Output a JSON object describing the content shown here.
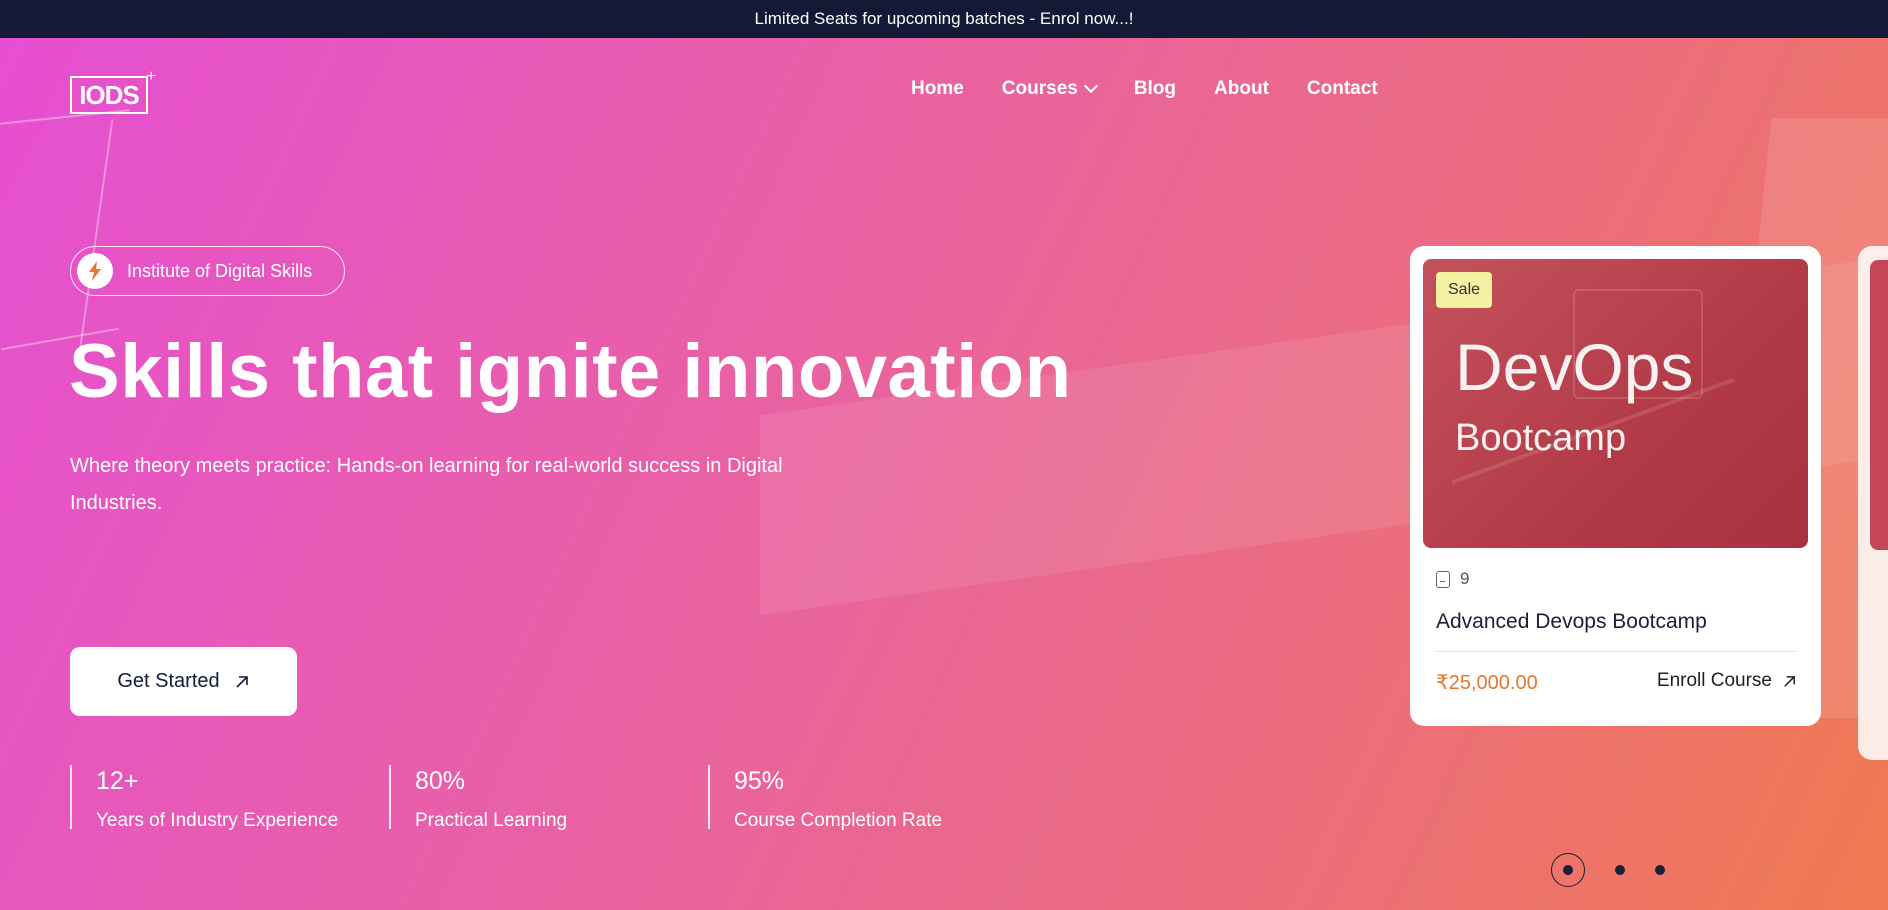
{
  "announcement": "Limited Seats for upcoming batches - Enrol now...!",
  "logo": {
    "text": "IODS",
    "icon": "logo-mark"
  },
  "nav": {
    "items": [
      "Home",
      "Courses",
      "Blog",
      "About",
      "Contact"
    ],
    "courses_has_dropdown": true
  },
  "hero": {
    "badge": "Institute of Digital Skills",
    "badge_icon": "lightning-icon",
    "headline": "Skills that ignite innovation",
    "subtitle": "Where theory meets practice: Hands-on learning for real-world success in Digital Industries.",
    "cta": "Get Started",
    "gradient": [
      "#e64fd2",
      "#e9639e",
      "#ec6f78",
      "#ef7a50"
    ]
  },
  "stats": [
    {
      "value": "12+",
      "label": "Years of Industry Experience"
    },
    {
      "value": "80%",
      "label": "Practical Learning"
    },
    {
      "value": "95%",
      "label": "Course Completion Rate"
    }
  ],
  "course_card": {
    "badge": "Sale",
    "image_title": "DevOps",
    "image_subtitle": "Bootcamp",
    "lessons": "9",
    "title": "Advanced Devops Bootcamp",
    "price": "₹25,000.00",
    "enroll_label": "Enroll Course",
    "price_color": "#e8762f"
  },
  "carousel": {
    "total_slides": 3,
    "active_index": 0
  }
}
